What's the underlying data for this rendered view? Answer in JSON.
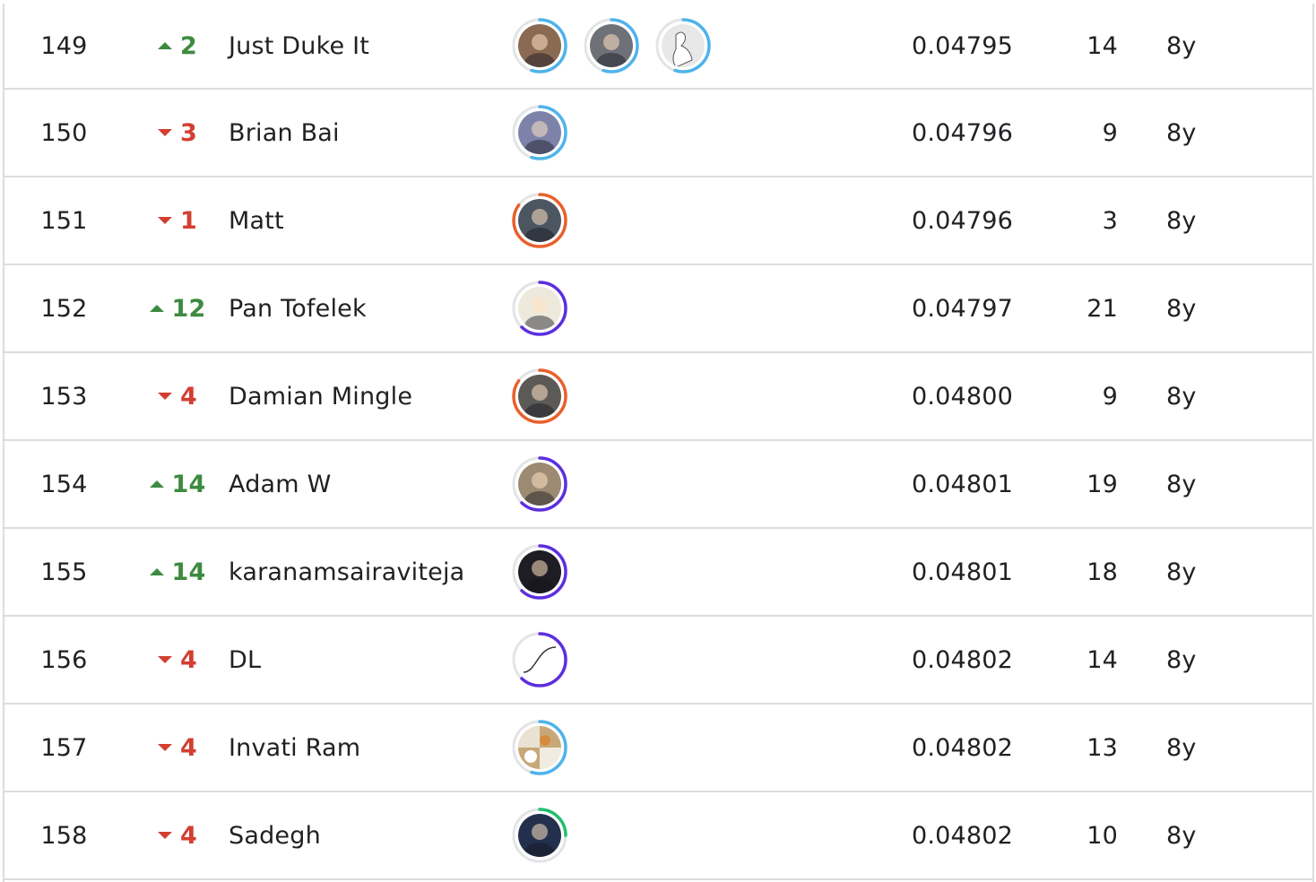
{
  "leaderboard": {
    "rows": [
      {
        "rank": "149",
        "direction": "up",
        "change": "2",
        "team": "Just Duke It",
        "score": "0.04795",
        "entries": "14",
        "last": "8y",
        "members": [
          {
            "icon": "avatar-photo-man-glasses",
            "tier_color": "#4fb3ea",
            "progress": 0.55,
            "bg": "#8a6a52"
          },
          {
            "icon": "avatar-photo-football-player",
            "tier_color": "#4fb3ea",
            "progress": 0.55,
            "bg": "#6f7178"
          },
          {
            "icon": "avatar-goose-drawing",
            "tier_color": "#4fb3ea",
            "progress": 0.55,
            "bg": "#e8e8e8"
          }
        ]
      },
      {
        "rank": "150",
        "direction": "down",
        "change": "3",
        "team": "Brian Bai",
        "score": "0.04796",
        "entries": "9",
        "last": "8y",
        "members": [
          {
            "icon": "avatar-photo-person-outdoors",
            "tier_color": "#4fb3ea",
            "progress": 0.55,
            "bg": "#7d83a8"
          }
        ]
      },
      {
        "rank": "151",
        "direction": "down",
        "change": "1",
        "team": "Matt",
        "score": "0.04796",
        "entries": "3",
        "last": "8y",
        "members": [
          {
            "icon": "avatar-photo-grayscale-portrait",
            "tier_color": "#e8602c",
            "progress": 0.85,
            "bg": "#4c5660"
          }
        ]
      },
      {
        "rank": "152",
        "direction": "up",
        "change": "12",
        "team": "Pan Tofelek",
        "score": "0.04797",
        "entries": "21",
        "last": "8y",
        "members": [
          {
            "icon": "avatar-photo-man-sketch",
            "tier_color": "#5b2ee0",
            "progress": 0.62,
            "bg": "#ede9dc"
          }
        ]
      },
      {
        "rank": "153",
        "direction": "down",
        "change": "4",
        "team": "Damian Mingle",
        "score": "0.04800",
        "entries": "9",
        "last": "8y",
        "members": [
          {
            "icon": "avatar-photo-bearded-man",
            "tier_color": "#e8602c",
            "progress": 0.85,
            "bg": "#5c5a57"
          }
        ]
      },
      {
        "rank": "154",
        "direction": "up",
        "change": "14",
        "team": "Adam W",
        "score": "0.04801",
        "entries": "19",
        "last": "8y",
        "members": [
          {
            "icon": "avatar-photo-man-landscape",
            "tier_color": "#5b2ee0",
            "progress": 0.62,
            "bg": "#9c8a72"
          }
        ]
      },
      {
        "rank": "155",
        "direction": "up",
        "change": "14",
        "team": "karanamsairaviteja",
        "score": "0.04801",
        "entries": "18",
        "last": "8y",
        "members": [
          {
            "icon": "avatar-photo-man-dark",
            "tier_color": "#5b2ee0",
            "progress": 0.62,
            "bg": "#1e1d24"
          }
        ]
      },
      {
        "rank": "156",
        "direction": "down",
        "change": "4",
        "team": "DL",
        "score": "0.04802",
        "entries": "14",
        "last": "8y",
        "members": [
          {
            "icon": "avatar-sigmoid-curve",
            "tier_color": "#5b2ee0",
            "progress": 0.62,
            "bg": "#ffffff"
          }
        ]
      },
      {
        "rank": "157",
        "direction": "down",
        "change": "4",
        "team": "Invati Ram",
        "score": "0.04802",
        "entries": "13",
        "last": "8y",
        "members": [
          {
            "icon": "avatar-photo-food-collage",
            "tier_color": "#4fb3ea",
            "progress": 0.55,
            "bg": "#c8a878"
          }
        ]
      },
      {
        "rank": "158",
        "direction": "down",
        "change": "4",
        "team": "Sadegh",
        "score": "0.04802",
        "entries": "10",
        "last": "8y",
        "members": [
          {
            "icon": "avatar-photo-blue-scene",
            "tier_color": "#20be6e",
            "progress": 0.25,
            "bg": "#23304d"
          }
        ]
      }
    ]
  }
}
